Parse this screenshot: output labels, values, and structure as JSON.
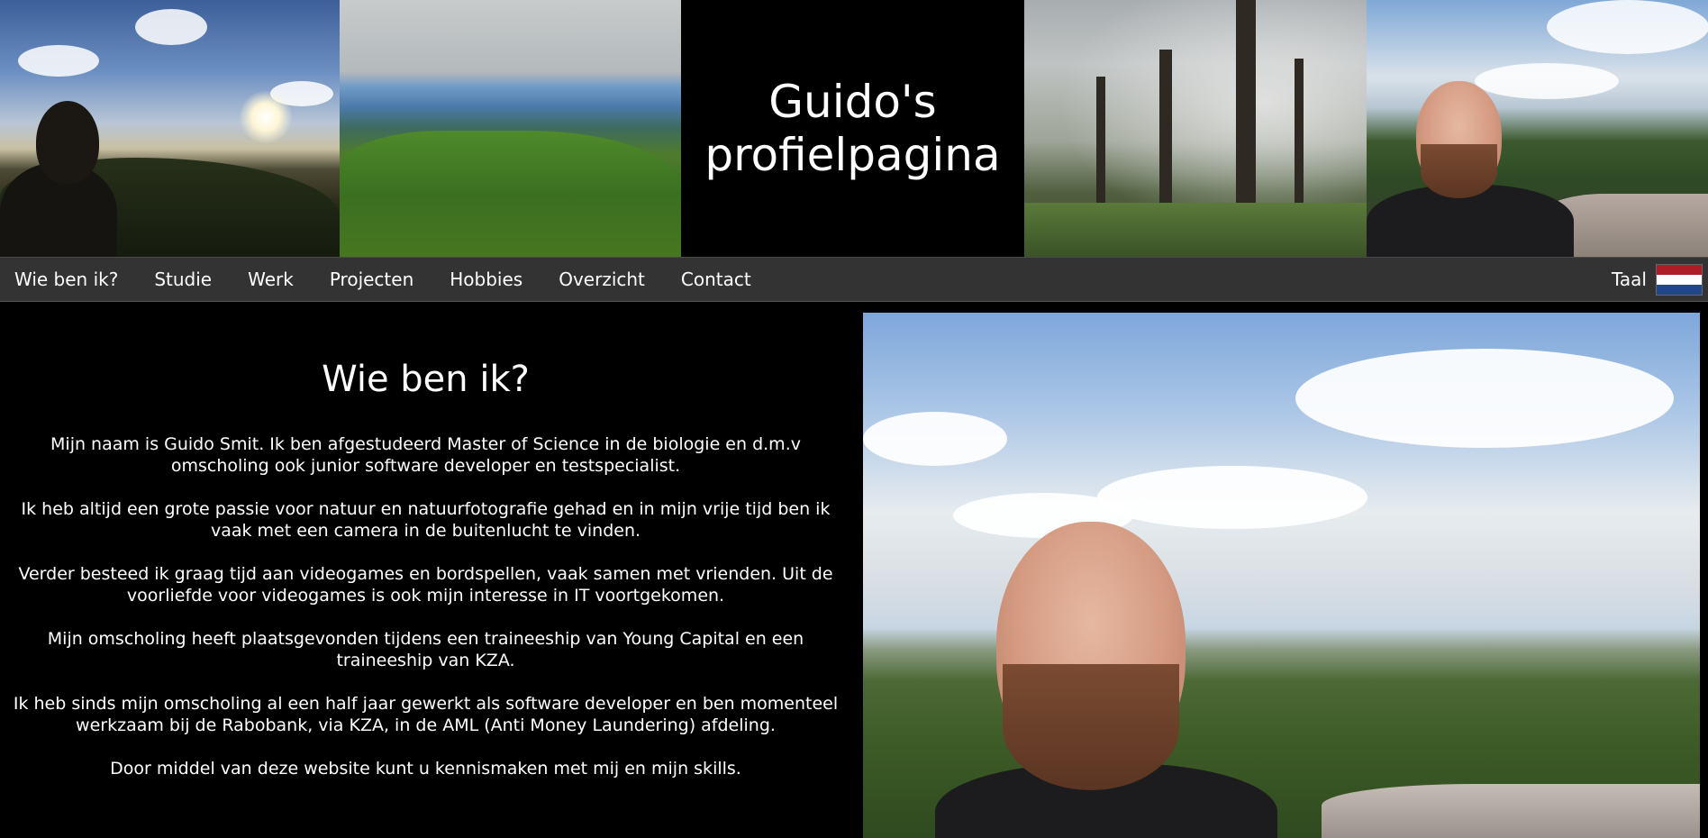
{
  "header": {
    "title_line1": "Guido's",
    "title_line2": "profielpagina"
  },
  "nav": {
    "items": [
      {
        "label": "Wie ben ik?"
      },
      {
        "label": "Studie"
      },
      {
        "label": "Werk"
      },
      {
        "label": "Projecten"
      },
      {
        "label": "Hobbies"
      },
      {
        "label": "Overzicht"
      },
      {
        "label": "Contact"
      }
    ],
    "language_label": "Taal",
    "language_flag": "netherlands-flag-icon"
  },
  "intro": {
    "heading": "Wie ben ik?",
    "paragraphs": [
      "Mijn naam is Guido Smit. Ik ben afgestudeerd Master of Science in de biologie en d.m.v omscholing ook junior software developer en testspecialist.",
      "Ik heb altijd een grote passie voor natuur en natuurfotografie gehad en in mijn vrije tijd ben ik vaak met een camera in de buitenlucht te vinden.",
      "Verder besteed ik graag tijd aan videogames en bordspellen, vaak samen met vrienden. Uit de voorliefde voor videogames is ook mijn interesse in IT voortgekomen.",
      "Mijn omscholing heeft plaatsgevonden tijdens een traineeship van Young Capital en een traineeship van KZA.",
      "Ik heb sinds mijn omscholing al een half jaar gewerkt als software developer en ben momenteel werkzaam bij de Rabobank, via KZA, in de AML (Anti Money Laundering) afdeling.",
      "Door middel van deze website kunt u kennismaken met mij en mijn skills."
    ]
  },
  "colors": {
    "background": "#000000",
    "nav_background": "#333333",
    "text": "#ffffff"
  }
}
